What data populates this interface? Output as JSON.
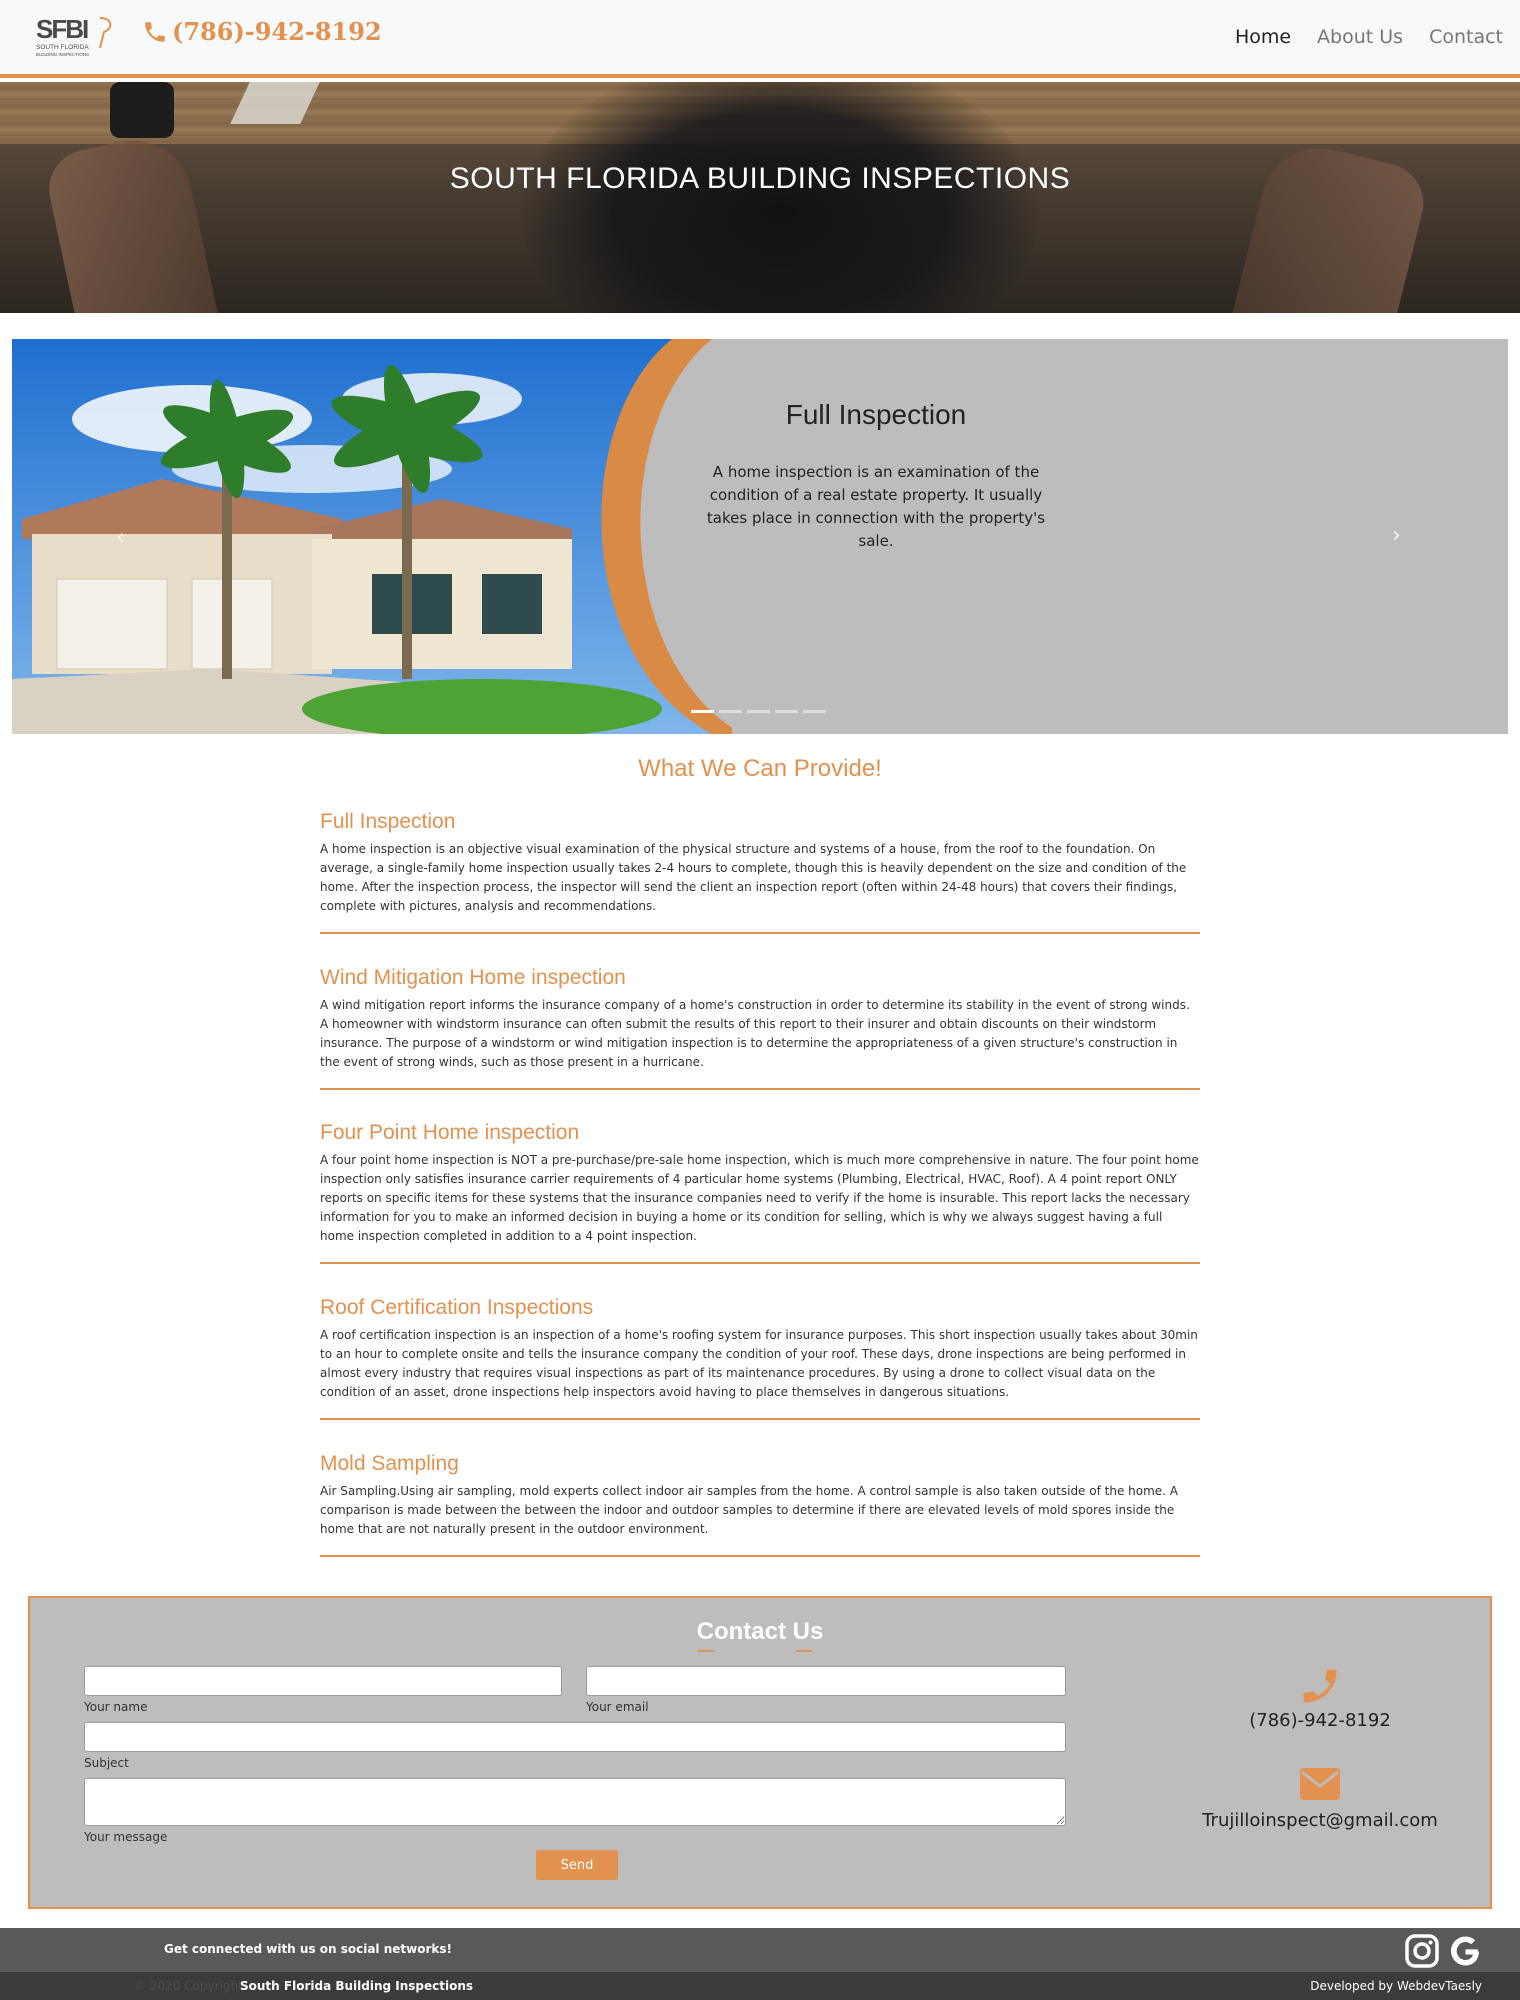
{
  "navbar": {
    "logo_text": "SFBI",
    "logo_subtext": "SOUTH FLORIDA",
    "logo_subtext2": "BUILDING INSPECTIONS",
    "phone": "(786)-942-8192",
    "links": [
      {
        "label": "Home",
        "active": true
      },
      {
        "label": "About Us",
        "active": false
      },
      {
        "label": "Contact",
        "active": false
      }
    ]
  },
  "hero": {
    "title": "SOUTH FLORIDA BUILDING INSPECTIONS"
  },
  "carousel": {
    "slide_title": "Full Inspection",
    "slide_text": "A home inspection is an examination of the condition of a real estate property. It usually takes place in connection with the property's sale.",
    "prev_glyph": "‹",
    "next_glyph": "›",
    "slide_count": 5,
    "active_index": 0
  },
  "services": {
    "title": "What We Can Provide!",
    "items": [
      {
        "title": "Full Inspection",
        "text": "A home inspection is an objective visual examination of the physical structure and systems of a house, from the roof to the foundation. On average, a single-family home inspection usually takes 2-4 hours to complete, though this is heavily dependent on the size and condition of the home. After the inspection process, the inspector will send the client an inspection report (often within 24-48 hours) that covers their findings, complete with pictures, analysis and recommendations."
      },
      {
        "title": "Wind Mitigation Home inspection",
        "text": "A wind mitigation report informs the insurance company of a home's construction in order to determine its stability in the event of strong winds. A homeowner with windstorm insurance can often submit the results of this report to their insurer and obtain discounts on their windstorm insurance. The purpose of a windstorm or wind mitigation inspection is to determine the appropriateness of a given structure's construction in the event of strong winds, such as those present in a hurricane."
      },
      {
        "title": "Four Point Home inspection",
        "text": "A four point home inspection is NOT a pre-purchase/pre-sale home inspection, which is much more comprehensive in nature. The four point home inspection only satisfies insurance carrier requirements of 4 particular home systems (Plumbing, Electrical, HVAC, Roof). A 4 point report ONLY reports on specific items for these systems that the insurance companies need to verify if the home is insurable. This report lacks the necessary information for you to make an informed decision in buying a home or its condition for selling, which is why we always suggest having a full home inspection completed in addition to a 4 point inspection."
      },
      {
        "title": "Roof Certification Inspections",
        "text": "A roof certification inspection is an inspection of a home's roofing system for insurance purposes. This short inspection usually takes about 30min to an hour to complete onsite and tells the insurance company the condition of your roof. These days, drone inspections are being performed in almost every industry that requires visual inspections as part of its maintenance procedures. By using a drone to collect visual data on the condition of an asset, drone inspections help inspectors avoid having to place themselves in dangerous situations."
      },
      {
        "title": "Mold Sampling",
        "text": "Air Sampling.Using air sampling, mold experts collect indoor air samples from the home. A control sample is also taken outside of the home. A comparison is made between the between the indoor and outdoor samples to determine if there are elevated levels of mold spores inside the home that are not naturally present in the outdoor environment."
      }
    ]
  },
  "contact": {
    "title": "Contact Us",
    "name_label": "Your name",
    "email_label": "Your email",
    "subject_label": "Subject",
    "message_label": "Your message",
    "send_label": "Send",
    "phone": "(786)-942-8192",
    "email": "Trujilloinspect@gmail.com"
  },
  "footer": {
    "social_text": "Get connected with us on social networks!",
    "copyright": "© 2020 Copyright:",
    "brand": "South Florida Building Inspections",
    "developed": "Developed by WebdevTaesly"
  },
  "colors": {
    "accent": "#e2914e",
    "panel": "#bdbdbd",
    "footer_top": "#595959",
    "footer_bottom": "#3b3b3b"
  },
  "icons": {
    "phone": "phone-icon",
    "mail": "envelope-icon",
    "instagram": "instagram-icon",
    "google": "google-icon"
  }
}
